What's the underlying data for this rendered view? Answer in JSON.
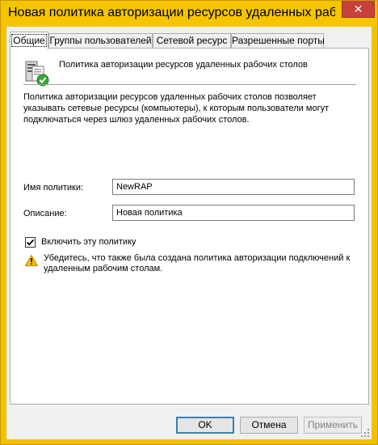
{
  "window": {
    "title": "Новая политика авторизации ресурсов удаленных рабочих столов",
    "close_glyph": "✕"
  },
  "tabs": [
    {
      "label": "Общие",
      "active": true
    },
    {
      "label": "Группы пользователей",
      "active": false
    },
    {
      "label": "Сетевой ресурс",
      "active": false
    },
    {
      "label": "Разрешенные порты",
      "active": false
    }
  ],
  "general": {
    "heading": "Политика авторизации ресурсов удаленных рабочих столов",
    "description": "Политика авторизации ресурсов удаленных рабочих столов позволяет указывать сетевые ресурсы (компьютеры), к которым пользователи могут подключаться через шлюз удаленных рабочих столов.",
    "policy_name_label": "Имя политики:",
    "policy_name_value": "NewRAP",
    "description_label": "Описание:",
    "description_value": "Новая политика",
    "enable_label": "Включить эту политику",
    "enable_checked": true,
    "warning_text": "Убедитесь, что также была создана политика авторизации подключений к удаленным рабочим столам."
  },
  "buttons": {
    "ok": "OK",
    "cancel": "Отмена",
    "apply": "Применить"
  },
  "colors": {
    "titlebar": "#f4c500",
    "close": "#c7413a",
    "warning": "#f2c200",
    "check_green": "#3aa63a"
  },
  "icons": {
    "policy": "server-policy-icon",
    "warning": "warning-triangle-icon",
    "check": "checkmark-icon"
  }
}
